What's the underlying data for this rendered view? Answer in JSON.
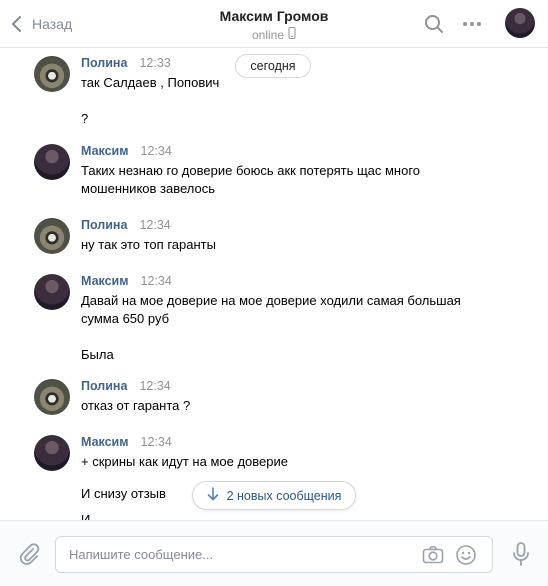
{
  "header": {
    "back_label": "Назад",
    "title": "Максим Громов",
    "status": "online"
  },
  "date_separator": "сегодня",
  "messages": [
    {
      "author": "Полина",
      "time": "12:33",
      "lines": [
        "так Салдаев , Попович",
        "?"
      ]
    },
    {
      "author": "Максим",
      "time": "12:34",
      "lines": [
        "Таких незнаю го доверие боюсь акк потерять щас много мошенников завелось"
      ]
    },
    {
      "author": "Полина",
      "time": "12:34",
      "lines": [
        "ну так это топ гаранты"
      ]
    },
    {
      "author": "Максим",
      "time": "12:34",
      "lines": [
        "Давай на мое доверие на мое доверие ходили самая большая сумма 650 руб",
        "Была"
      ]
    },
    {
      "author": "Полина",
      "time": "12:34",
      "lines": [
        "отказ от гаранта ?"
      ]
    },
    {
      "author": "Максим",
      "time": "12:34",
      "lines": [
        "+ скрины как идут на мое доверие",
        "И снизу отзыв",
        "И..."
      ]
    }
  ],
  "new_messages_label": "2 новых сообщения",
  "composer": {
    "placeholder": "Напишите сообщение..."
  },
  "colors": {
    "link_blue": "#42648b",
    "accent_blue": "#2a5885",
    "muted_gray": "#939393",
    "icon_gray": "#828a99"
  },
  "icons": [
    "chevron-left-icon",
    "mobile-phone-icon",
    "search-icon",
    "more-icon",
    "paperclip-icon",
    "camera-icon",
    "smile-icon",
    "microphone-icon",
    "arrow-down-icon"
  ]
}
